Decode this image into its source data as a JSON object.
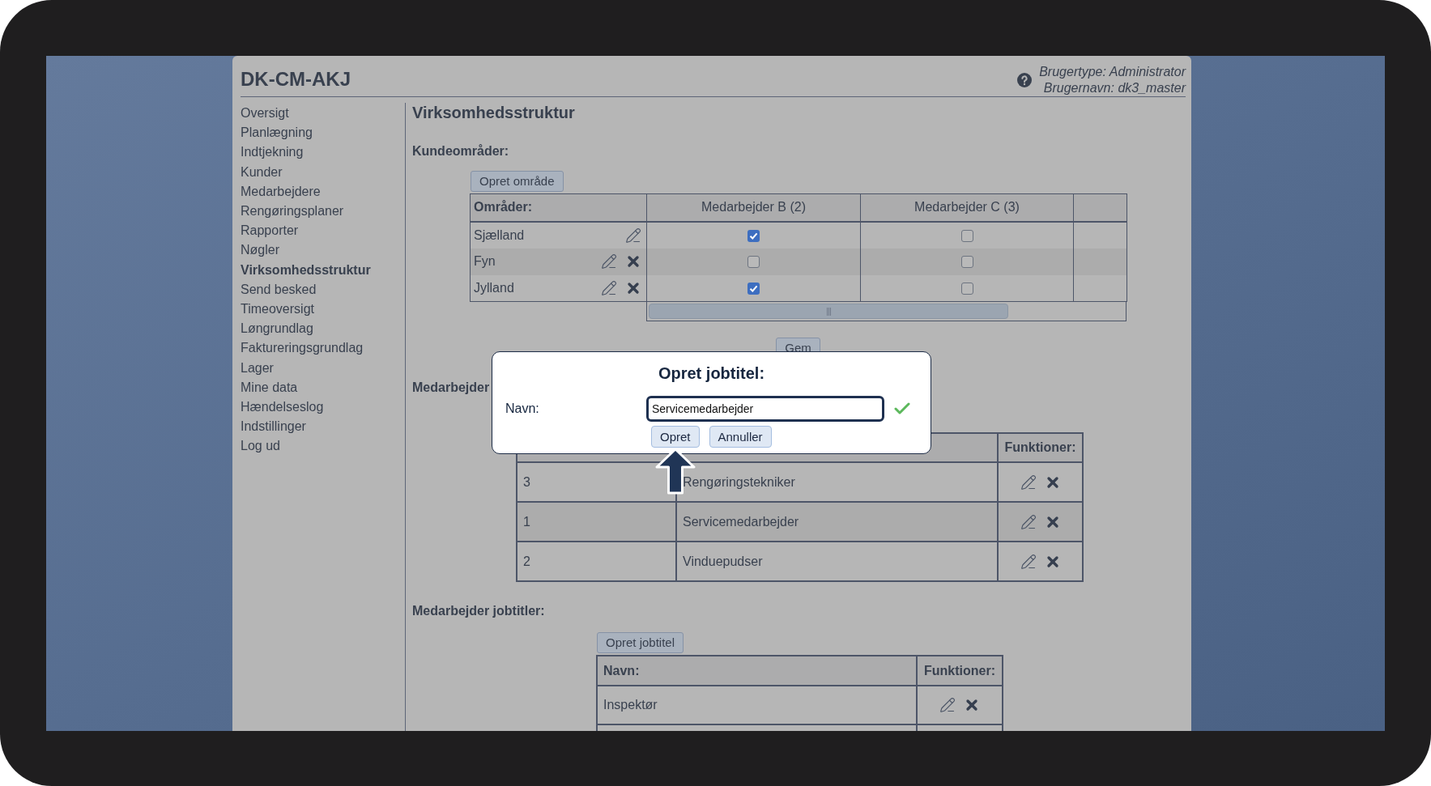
{
  "header": {
    "title": "DK-CM-AKJ",
    "user_type": "Brugertype: Administrator",
    "user_name": "Brugernavn: dk3_master"
  },
  "sidebar": {
    "items": [
      {
        "label": "Oversigt",
        "selected": false
      },
      {
        "label": "Planlægning",
        "selected": false
      },
      {
        "label": "Indtjekning",
        "selected": false
      },
      {
        "label": "Kunder",
        "selected": false
      },
      {
        "label": "Medarbejdere",
        "selected": false
      },
      {
        "label": "Rengøringsplaner",
        "selected": false
      },
      {
        "label": "Rapporter",
        "selected": false
      },
      {
        "label": "Nøgler",
        "selected": false
      },
      {
        "label": "Virksomhedsstruktur",
        "selected": true
      },
      {
        "label": "Send besked",
        "selected": false
      },
      {
        "label": "Timeoversigt",
        "selected": false
      },
      {
        "label": "Løngrundlag",
        "selected": false
      },
      {
        "label": "Faktureringsgrundlag",
        "selected": false
      },
      {
        "label": "Lager",
        "selected": false
      },
      {
        "label": "Mine data",
        "selected": false
      },
      {
        "label": "Hændelseslog",
        "selected": false
      },
      {
        "label": "Indstillinger",
        "selected": false
      },
      {
        "label": "Log ud",
        "selected": false
      }
    ]
  },
  "content": {
    "title": "Virksomhedsstruktur",
    "customer_areas": {
      "heading": "Kundeområder:",
      "create_button": "Opret område",
      "columns": [
        "Områder:",
        "Medarbejder B (2)",
        "Medarbejder C (3)"
      ],
      "rows": [
        {
          "name": "Sjælland",
          "deletable": false,
          "cells": [
            {
              "checked": true
            },
            {
              "checked": false
            }
          ]
        },
        {
          "name": "Fyn",
          "deletable": true,
          "cells": [
            {
              "checked": false
            },
            {
              "checked": false
            }
          ]
        },
        {
          "name": "Jylland",
          "deletable": true,
          "cells": [
            {
              "checked": true
            },
            {
              "checked": false
            }
          ]
        }
      ],
      "save_button": "Gem"
    },
    "employee_groups": {
      "heading": "Medarbejder",
      "column_3": "Funktioner:",
      "rows": [
        {
          "column_1": "3",
          "column_2": "Rengøringstekniker"
        },
        {
          "column_1": "1",
          "column_2": "Servicemedarbejder"
        },
        {
          "column_1": "2",
          "column_2": "Vinduepudser"
        }
      ]
    },
    "job_titles": {
      "heading": "Medarbejder jobtitler:",
      "create_button": "Opret jobtitel",
      "columns": [
        "Navn:",
        "Funktioner:"
      ],
      "rows": [
        {
          "name": "Inspektør"
        }
      ]
    }
  },
  "dialog": {
    "title": "Opret jobtitel:",
    "field_label": "Navn:",
    "field_value": "Servicemedarbejder",
    "valid": true,
    "buttons": [
      {
        "label": "Opret",
        "pointed": true
      },
      {
        "label": "Annuller",
        "pointed": false
      }
    ]
  }
}
